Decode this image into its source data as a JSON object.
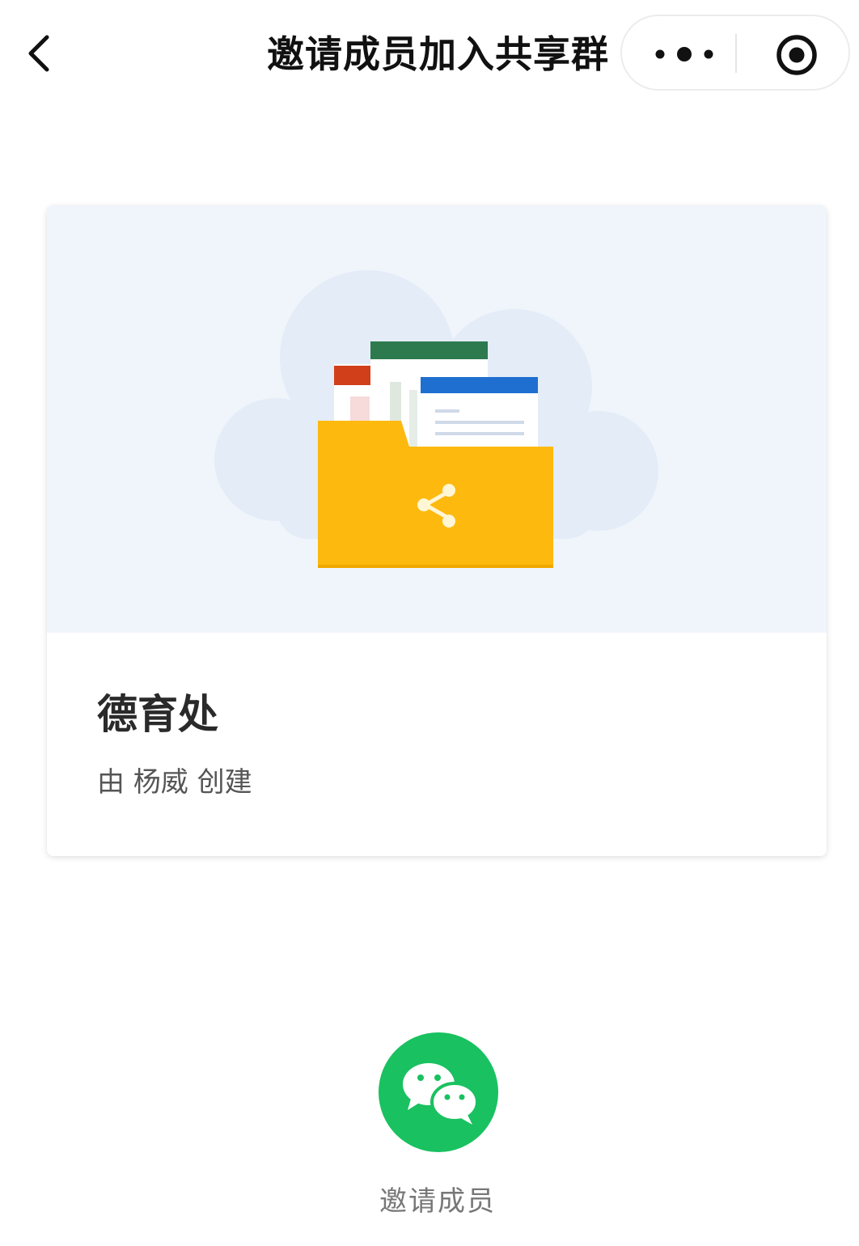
{
  "navbar": {
    "title": "邀请成员加入共享群",
    "back_icon": "chevron-left-icon",
    "more_icon": "more-dots-icon",
    "close_icon": "record-circle-icon"
  },
  "card": {
    "group_name": "德育处",
    "creator_text": "由 杨威 创建",
    "illustration": "shared-folder-cloud-illustration"
  },
  "invite": {
    "label": "邀请成员",
    "icon": "wechat-icon"
  },
  "colors": {
    "wechat_green": "#19c160",
    "folder_yellow": "#fdb90e",
    "hero_background": "#f0f5fb"
  }
}
